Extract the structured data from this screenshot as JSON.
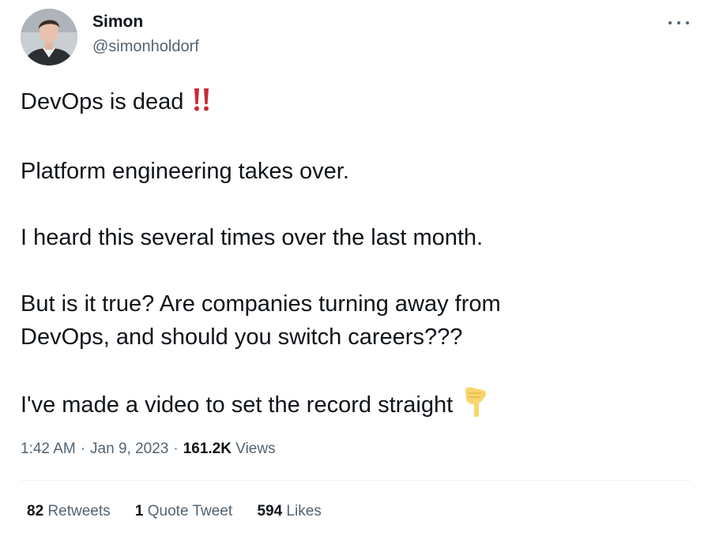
{
  "author": {
    "display_name": "Simon",
    "handle": "@simonholdorf",
    "avatar_icon": "profile-photo"
  },
  "menu_icon": "more-horizontal-icon",
  "tweet": {
    "line1": "DevOps is dead",
    "line1_emoji": "double-exclamation-icon",
    "line2": "Platform engineering takes over.",
    "line3": "I heard this several times over the last month.",
    "line4a": "But is it true? Are companies turning away from",
    "line4b": "DevOps, and should you switch careers???",
    "line5": "I've made a video to set the record straight",
    "line5_emoji": "pointing-down-icon"
  },
  "meta": {
    "time": "1:42 AM",
    "date": "Jan 9, 2023",
    "views_count": "161.2K",
    "views_label": "Views"
  },
  "stats": {
    "retweets_count": "82",
    "retweets_label": "Retweets",
    "quotes_count": "1",
    "quotes_label": "Quote Tweet",
    "likes_count": "594",
    "likes_label": "Likes"
  },
  "colors": {
    "text": "#0f1419",
    "secondary": "#536471",
    "divider": "#eff3f4",
    "exclamation": "#c72c34",
    "emoji_hand": "#f7d66b"
  }
}
